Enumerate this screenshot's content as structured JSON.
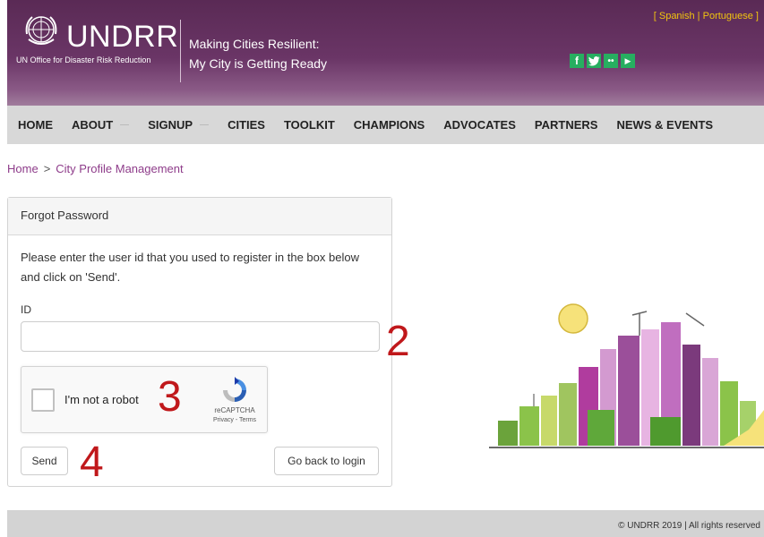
{
  "header": {
    "languages": {
      "open": "[ ",
      "spanish": "Spanish",
      "sep": " | ",
      "portuguese": "Portuguese",
      "close": " ]"
    },
    "logo_name": "UNDRR",
    "logo_sub": "UN Office for Disaster Risk Reduction",
    "tagline_line1": "Making Cities Resilient:",
    "tagline_line2": "My City is Getting Ready",
    "social": [
      {
        "icon": "facebook-icon",
        "glyph": "f"
      },
      {
        "icon": "twitter-icon",
        "glyph": "t"
      },
      {
        "icon": "flickr-icon",
        "glyph": "••"
      },
      {
        "icon": "youtube-icon",
        "glyph": "▶"
      }
    ]
  },
  "nav": {
    "items": [
      {
        "label": "HOME",
        "dropdown": false
      },
      {
        "label": "ABOUT",
        "dropdown": true
      },
      {
        "label": "SIGNUP",
        "dropdown": true
      },
      {
        "label": "CITIES",
        "dropdown": false
      },
      {
        "label": "TOOLKIT",
        "dropdown": false
      },
      {
        "label": "CHAMPIONS",
        "dropdown": false
      },
      {
        "label": "ADVOCATES",
        "dropdown": false
      },
      {
        "label": "PARTNERS",
        "dropdown": false
      },
      {
        "label": "NEWS & EVENTS",
        "dropdown": false
      }
    ]
  },
  "breadcrumb": {
    "home": "Home",
    "separator": ">",
    "current": "City Profile Management"
  },
  "form": {
    "title": "Forgot Password",
    "instructions": "Please enter the user id that you used to register in the box below and click on 'Send'.",
    "id_label": "ID",
    "id_value": "",
    "captcha": {
      "label": "I'm not a robot",
      "brand": "reCAPTCHA",
      "links": "Privacy - Terms"
    },
    "send_label": "Send",
    "back_label": "Go back to login"
  },
  "annotations": {
    "input": "2",
    "captcha": "3",
    "send": "4"
  },
  "footer": {
    "copyright": "© UNDRR 2019 | All rights reserved"
  },
  "colors": {
    "header": "#6a3566",
    "nav": "#d8d8d8",
    "link": "#8e3c8a",
    "annotation": "#c0181b",
    "social": "#27ae60",
    "language": "#f1c40f"
  }
}
